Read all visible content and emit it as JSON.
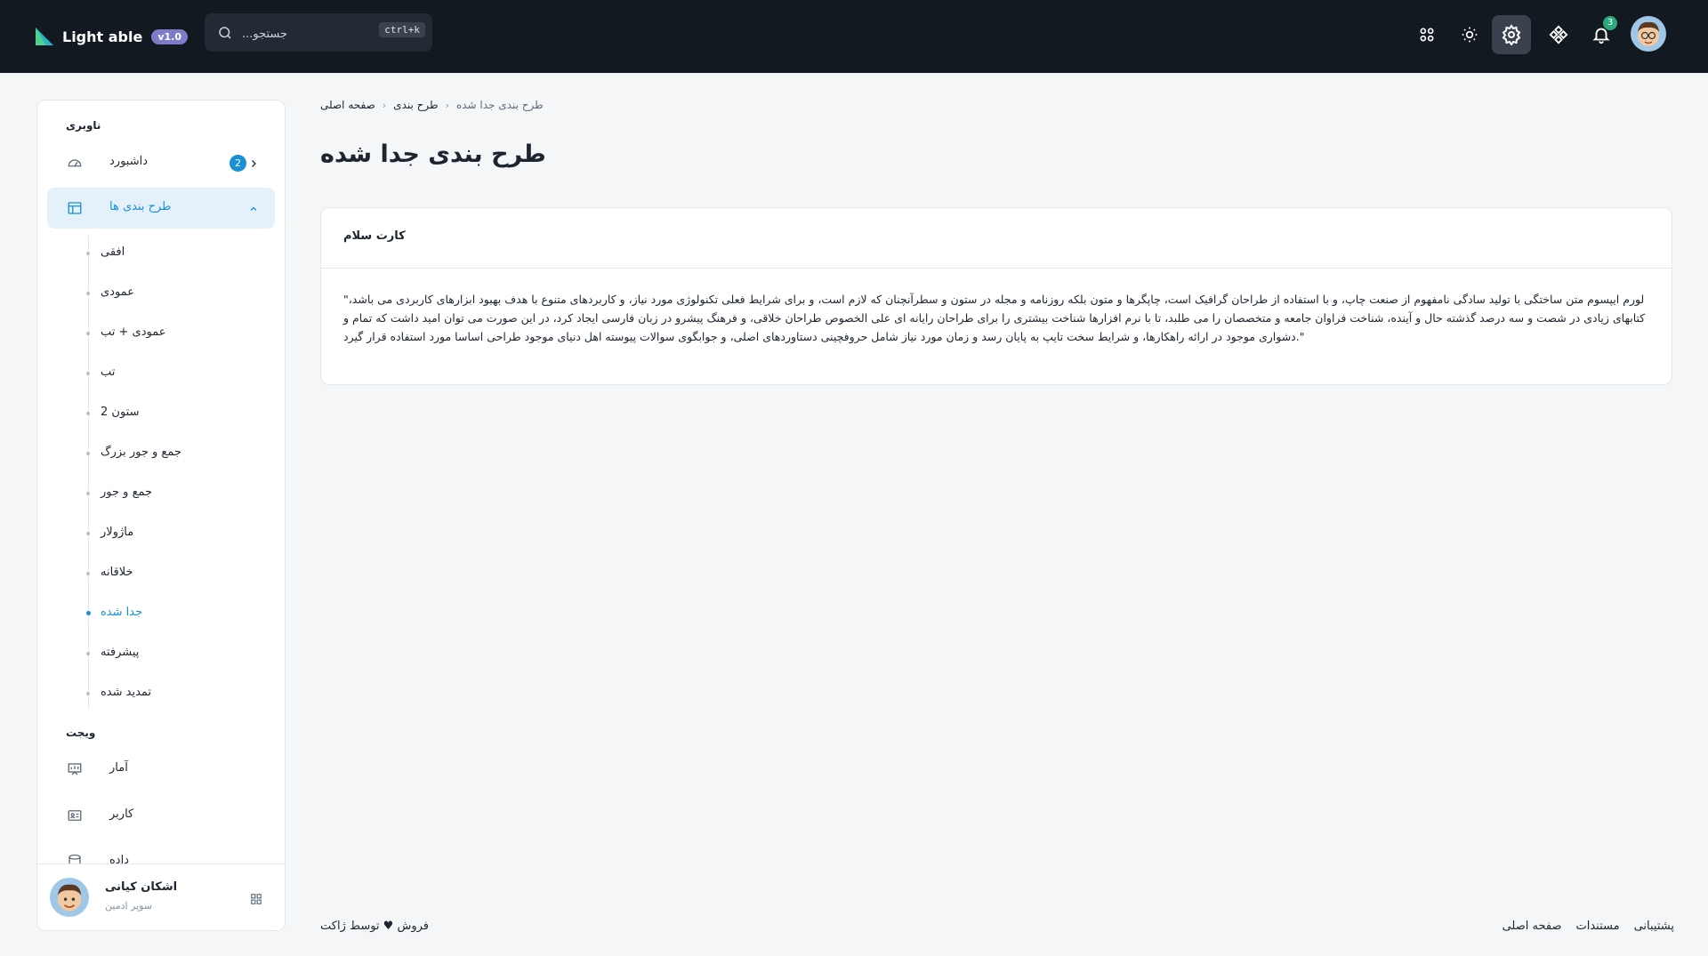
{
  "header": {
    "brand_name": "Light able",
    "version": "v1.0",
    "search_placeholder": "جستجو...",
    "search_shortcut": "ctrl+k",
    "notification_count": "3",
    "icons": [
      "apps-icon",
      "sun-icon",
      "gear-icon",
      "diamond-icon",
      "bell-icon"
    ]
  },
  "sidebar": {
    "nav_caption": "ناوبری",
    "items": [
      {
        "label": "داشبورد",
        "badge": "2",
        "icon": "dashboard-gauge-icon"
      },
      {
        "label": "طرح بندی ها",
        "icon": "layout-icon"
      }
    ],
    "sub_items": [
      {
        "label": "افقی"
      },
      {
        "label": "عمودی"
      },
      {
        "label": "عمودی + تب"
      },
      {
        "label": "تب"
      },
      {
        "label": "ستون 2"
      },
      {
        "label": "جمع و جور بزرگ"
      },
      {
        "label": "جمع و جور"
      },
      {
        "label": "ماژولار"
      },
      {
        "label": "خلاقانه"
      },
      {
        "label": "جدا شده"
      },
      {
        "label": "پیشرفته"
      },
      {
        "label": "تمدید شده"
      }
    ],
    "widget_caption": "ویجت",
    "widget_items": [
      {
        "label": "آمار",
        "icon": "stats-icon"
      },
      {
        "label": "کاربر",
        "icon": "user-card-icon"
      },
      {
        "label": "داده",
        "icon": "database-icon"
      }
    ],
    "user": {
      "name": "اشکان کیانی",
      "role": "سوپر ادمین"
    }
  },
  "breadcrumb": [
    "صفحه اصلی",
    "طرح بندی",
    "طرح بندی جدا شده"
  ],
  "page_title": "طرح بندی جدا شده",
  "card": {
    "title": "کارت سلام",
    "body": "\"لورم ایپسوم متن ساختگی با تولید سادگی نامفهوم از صنعت چاپ، و با استفاده از طراحان گرافیک است، چاپگرها و متون بلکه روزنامه و مجله در ستون و سطرآنچنان که لازم است، و برای شرایط فعلی تکنولوژی مورد نیاز، و کاربردهای متنوع با هدف بهبود ابزارهای کاربردی می باشد، کتابهای زیادی در شصت و سه درصد گذشته حال و آینده، شناخت فراوان جامعه و متخصصان را می طلبد، تا با نرم افزارها شناخت بیشتری را برای طراحان رایانه ای علی الخصوص طراحان خلاقی، و فرهنگ پیشرو در زبان فارسی ایجاد کرد، در این صورت می توان امید داشت که تمام و دشواری موجود در ارائه راهکارها، و شرایط سخت تایپ به پایان رسد و زمان مورد نیاز شامل حروفچینی دستاوردهای اصلی، و جوابگوی سوالات پیوسته اهل دنیای موجود طراحی اساسا مورد استفاده قرار گیرد.\""
  },
  "footer": {
    "left": "فروش ♥ توسط ژاکت",
    "links": [
      "صفحه اصلی",
      "مستندات",
      "پشتیبانی"
    ]
  },
  "colors": {
    "accent": "#1890d6",
    "header_bg": "#131920",
    "page_bg": "#f4f6f8",
    "badge_green": "#2ca87f",
    "version_badge": "#7c7cc9"
  }
}
